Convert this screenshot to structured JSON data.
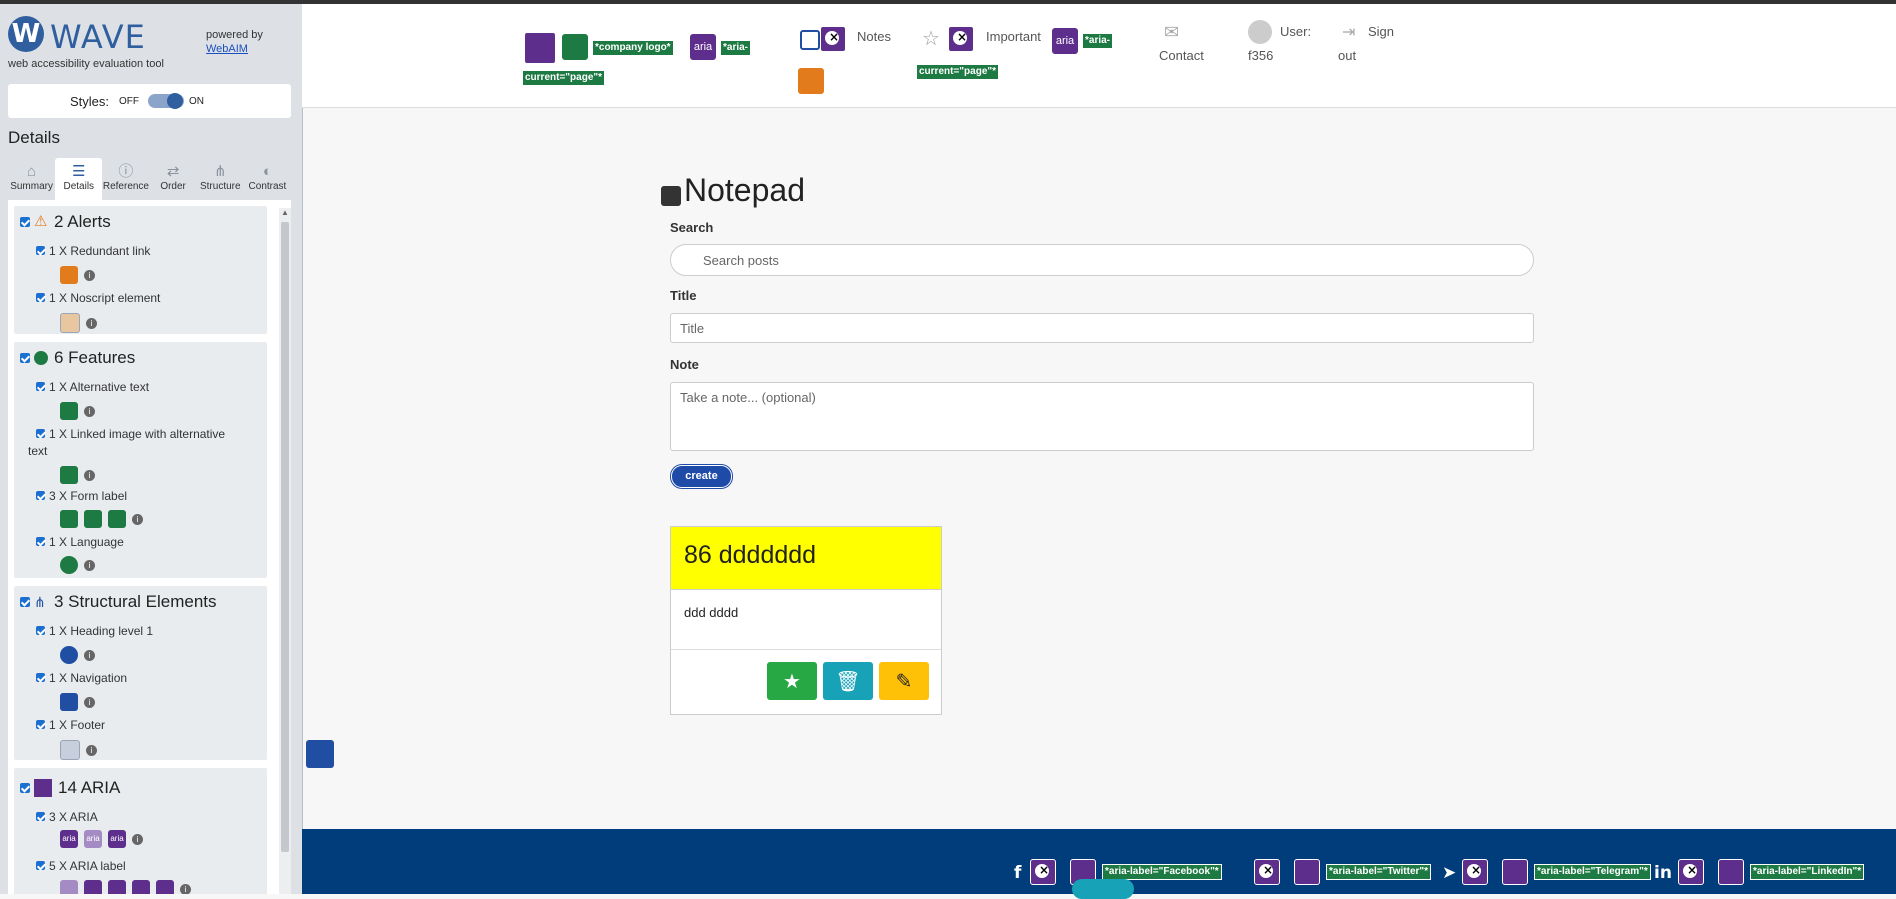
{
  "wave": {
    "logo_letter": "W",
    "title": "WAVE",
    "subtitle": "web accessibility evaluation tool",
    "powered_by": "powered by",
    "webaim_link": "WebAIM",
    "styles_label": "Styles:",
    "styles_off": "OFF",
    "styles_on": "ON",
    "details_heading": "Details",
    "tabs": [
      {
        "label": "Summary",
        "icon": "home-icon"
      },
      {
        "label": "Details",
        "icon": "list-icon"
      },
      {
        "label": "Reference",
        "icon": "info-icon"
      },
      {
        "label": "Order",
        "icon": "order-icon"
      },
      {
        "label": "Structure",
        "icon": "structure-icon"
      },
      {
        "label": "Contrast",
        "icon": "contrast-icon"
      }
    ],
    "sections": {
      "alerts": {
        "title": "2 Alerts",
        "items": [
          "1 X Redundant link",
          "1 X Noscript element"
        ]
      },
      "features": {
        "title": "6 Features",
        "items": [
          "1 X Alternative text",
          "1 X Linked image with alternative",
          "text",
          "3 X Form label",
          "1 X Language"
        ]
      },
      "structure": {
        "title": "3 Structural Elements",
        "items": [
          "1 X Heading level 1",
          "1 X Navigation",
          "1 X Footer"
        ]
      },
      "aria": {
        "title": "14 ARIA",
        "items": [
          "3 X ARIA",
          "5 X ARIA label"
        ]
      }
    }
  },
  "nav": {
    "company_logo_tag": "*company logo*",
    "aria_current_1a": "*aria-",
    "aria_current_1b": "current=\"page\"*",
    "notes": "Notes",
    "important": "Important",
    "aria_current_2a": "*aria-",
    "aria_current_2b": "current=\"page\"*",
    "contact": "Contact",
    "user_label": "User:",
    "user_name": "f356",
    "sign": "Sign",
    "out": "out",
    "aria_badge": "aria"
  },
  "main": {
    "heading": "Notepad",
    "search_label": "Search",
    "search_placeholder": "Search posts",
    "title_label": "Title",
    "title_placeholder": "Title",
    "note_label": "Note",
    "note_placeholder": "Take a note... (optional)",
    "create_button": "create",
    "card": {
      "title": "86 ddddddd",
      "body": "ddd dddd"
    }
  },
  "footer": {
    "tags": [
      "*aria-label=\"Facebook\"*",
      "*aria-label=\"Twitter\"*",
      "*aria-label=\"Telegram\"*",
      "*aria-label=\"LinkedIn\"*"
    ],
    "social_icons": [
      "facebook-icon",
      "twitter-icon",
      "telegram-icon",
      "linkedin-icon"
    ]
  },
  "colors": {
    "wave_blue": "#2f5f9e",
    "feature_green": "#1d7a43",
    "aria_purple": "#5d2e8c",
    "card_header": "#ffff00",
    "footer_bg": "#003d7a",
    "create_button": "#1e4aa8"
  }
}
